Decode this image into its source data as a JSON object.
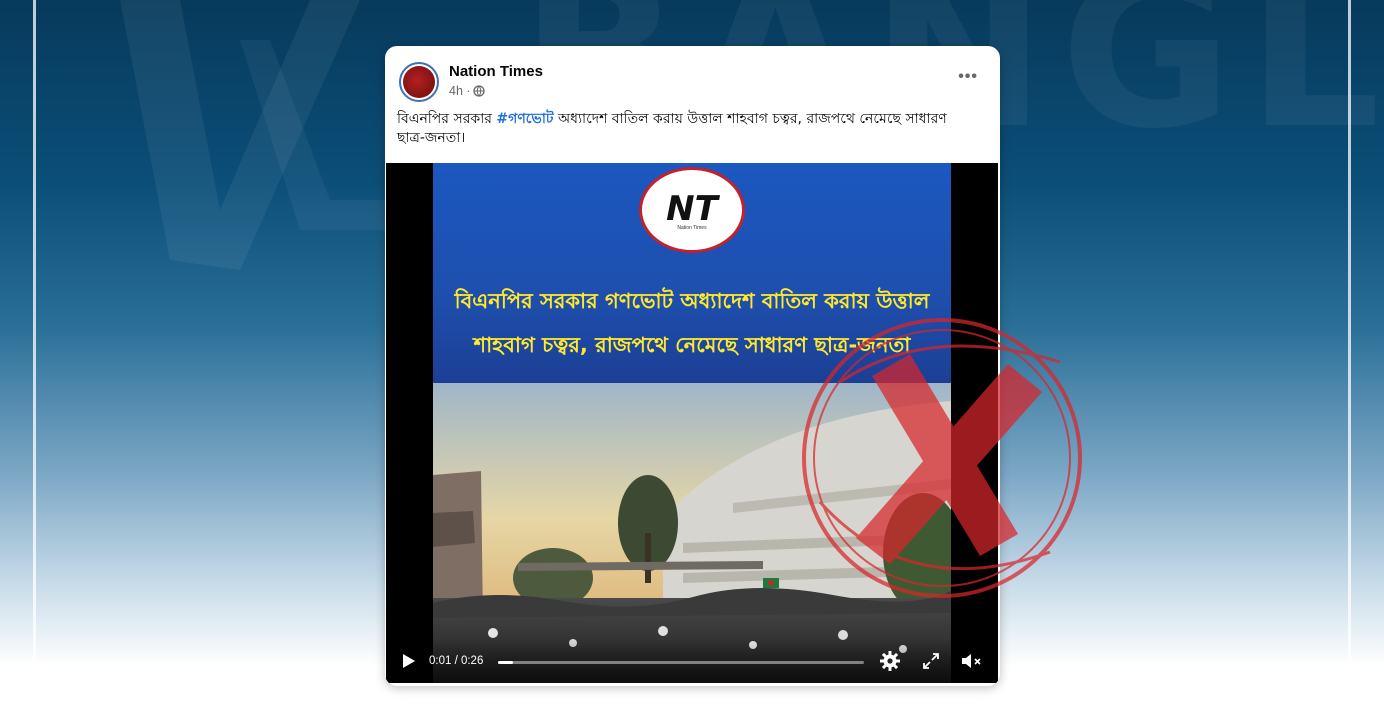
{
  "background": {
    "watermark_text": "BANGLA",
    "colors": {
      "top": "#073a5c",
      "bottom": "#ffffff",
      "frame": "#ffffff"
    }
  },
  "post": {
    "page_name": "Nation Times",
    "time": "4h ·",
    "privacy_icon": "globe-icon",
    "more_icon": "more-options-icon",
    "more_label": "•••",
    "text_before": "বিএনপির সরকার ",
    "hashtag": "#গণভোট",
    "text_after": " অধ্যাদেশ বাতিল করায় উত্তাল শাহবাগ চত্বর,  রাজপথে নেমেছে সাধারণ ছাত্র-জনতা।",
    "colors": {
      "name": "#050505",
      "meta": "#65676b",
      "hashtag": "#216fdb"
    }
  },
  "video": {
    "logo_mark": "NT",
    "logo_text": "Nation Times",
    "headline_line1": "বিএনপির সরকার গণভোট অধ্যাদেশ  বাতিল করায় উত্তাল",
    "headline_line2": "শাহবাগ চত্বর,  রাজপথে নেমেছে সাধারণ ছাত্র-জনতা",
    "time": "0:01 / 0:26",
    "progress_fraction": 0.04,
    "controls": {
      "play": "play-icon",
      "settings": "gear-icon",
      "fullscreen": "fullscreen-icon",
      "mute": "muted-speaker-icon"
    },
    "colors": {
      "banner": "#1b58c0",
      "headline": "#ffe92d",
      "logo_ring": "#c3212b"
    }
  },
  "overlay": {
    "stamp": "false-claim-x-icon",
    "color": "#d8262b"
  }
}
